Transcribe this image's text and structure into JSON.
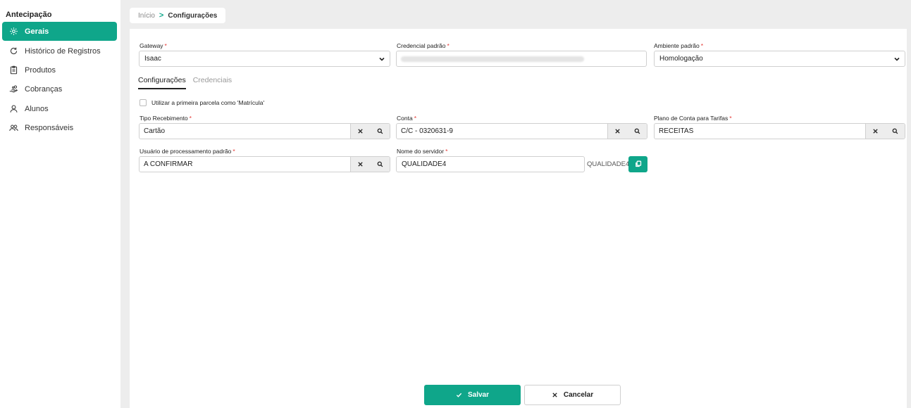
{
  "sidebar": {
    "section_title": "Antecipação",
    "items": [
      {
        "label": "Gerais",
        "icon": "gear-icon",
        "active": true
      },
      {
        "label": "Histórico de Registros",
        "icon": "refresh-icon"
      },
      {
        "label": "Produtos",
        "icon": "clipboard-icon"
      },
      {
        "label": "Cobranças",
        "icon": "hand-coins-icon"
      },
      {
        "label": "Alunos",
        "icon": "user-icon"
      },
      {
        "label": "Responsáveis",
        "icon": "users-icon"
      }
    ]
  },
  "breadcrumb": {
    "home": "Início",
    "separator": ">",
    "current": "Configurações"
  },
  "form": {
    "gateway": {
      "label": "Gateway",
      "required": "*",
      "value": "Isaac"
    },
    "credencial": {
      "label": "Credencial padrão",
      "required": "*"
    },
    "ambiente": {
      "label": "Ambiente padrão",
      "required": "*",
      "value": "Homologação"
    },
    "tabs": [
      "Configurações",
      "Credenciais"
    ],
    "checkbox_label": "Utilizar a primeira parcela como 'Matrícula'",
    "tipo_recebimento": {
      "label": "Tipo Recebimento",
      "required": "*",
      "value": "Cartão"
    },
    "conta": {
      "label": "Conta",
      "required": "*",
      "value": "C/C - 0320631-9"
    },
    "plano_conta": {
      "label": "Plano de Conta para Tarifas",
      "required": "*",
      "value": "RECEITAS"
    },
    "usuario": {
      "label": "Usuário de processamento padrão",
      "required": "*",
      "value": "A CONFIRMAR"
    },
    "servidor": {
      "label": "Nome do servidor",
      "required": "*",
      "value": "QUALIDADE4",
      "suffix": "QUALIDADE4"
    }
  },
  "actions": {
    "save": "Salvar",
    "cancel": "Cancelar"
  },
  "colors": {
    "accent": "#0fa68a",
    "required": "#e53935",
    "background_gray": "#ededed"
  }
}
